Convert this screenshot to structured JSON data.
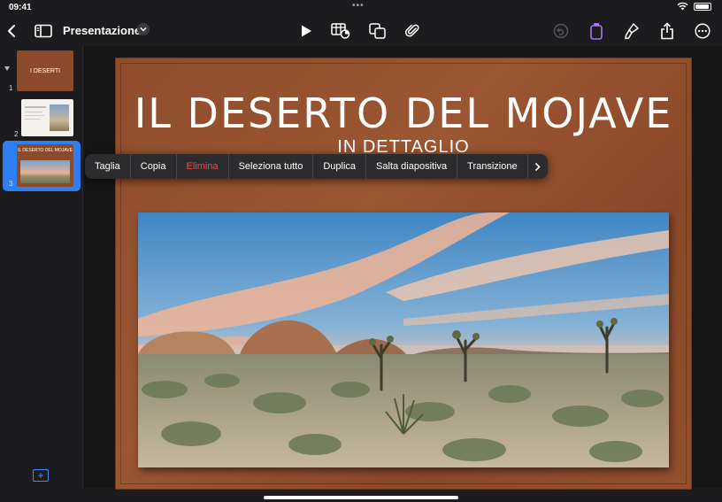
{
  "status": {
    "time": "09:41"
  },
  "toolbar": {
    "title": "Presentazione",
    "icons": [
      "back-icon",
      "sidebar-icon",
      "title-chevron-icon",
      "play-icon",
      "table-chart-icon",
      "shapes-icon",
      "attachment-icon",
      "undo-icon",
      "format-icon",
      "brush-icon",
      "share-icon",
      "more-icon"
    ],
    "accent": "#a577ff"
  },
  "navigator": {
    "slides": [
      {
        "number": "1",
        "thumb_text": "I DESERTI"
      },
      {
        "number": "2"
      },
      {
        "number": "3",
        "thumb_text": "IL DESERTO DEL MOJAVE"
      }
    ],
    "selected_color": "#2f7ef5"
  },
  "slide": {
    "title": "IL DESERTO DEL MOJAVE",
    "subtitle": "IN DETTAGLIO",
    "background": "#8f4d2c"
  },
  "context_menu": {
    "items": [
      {
        "label": "Taglia"
      },
      {
        "label": "Copia"
      },
      {
        "label": "Elimina",
        "color": "#ff453a"
      },
      {
        "label": "Seleziona tutto"
      },
      {
        "label": "Duplica"
      },
      {
        "label": "Salta diapositiva"
      },
      {
        "label": "Transizione"
      }
    ]
  }
}
